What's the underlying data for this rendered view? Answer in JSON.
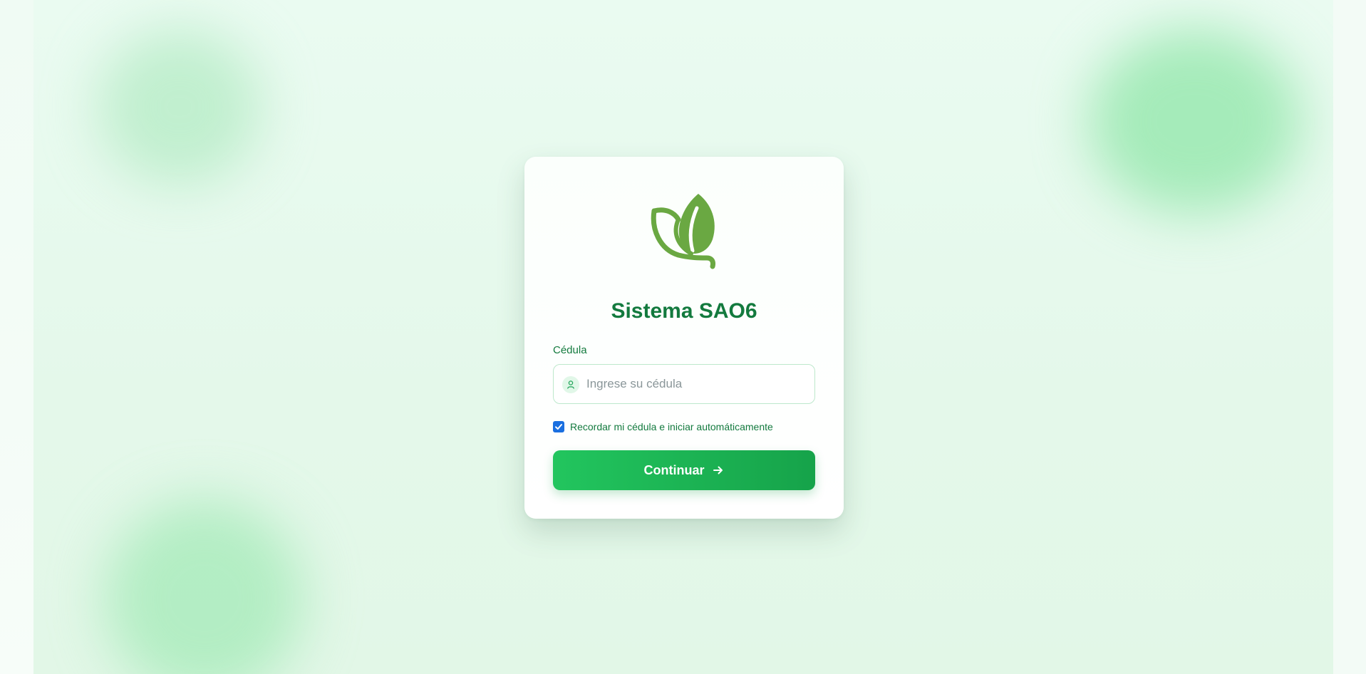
{
  "app": {
    "title": "Sistema SAO6",
    "logo_icon": "leaf-icon",
    "brand_color": "#137a3e",
    "logo_color": "#6aa842"
  },
  "login": {
    "field_label": "Cédula",
    "field_icon": "user-icon",
    "input_value": "",
    "input_placeholder": "Ingrese su cédula",
    "remember_checked": true,
    "remember_label": "Recordar mi cédula e iniciar automáticamente",
    "submit_label": "Continuar",
    "submit_icon": "arrow-right-icon",
    "button_color_start": "#22c55e",
    "button_color_end": "#16a34a"
  }
}
